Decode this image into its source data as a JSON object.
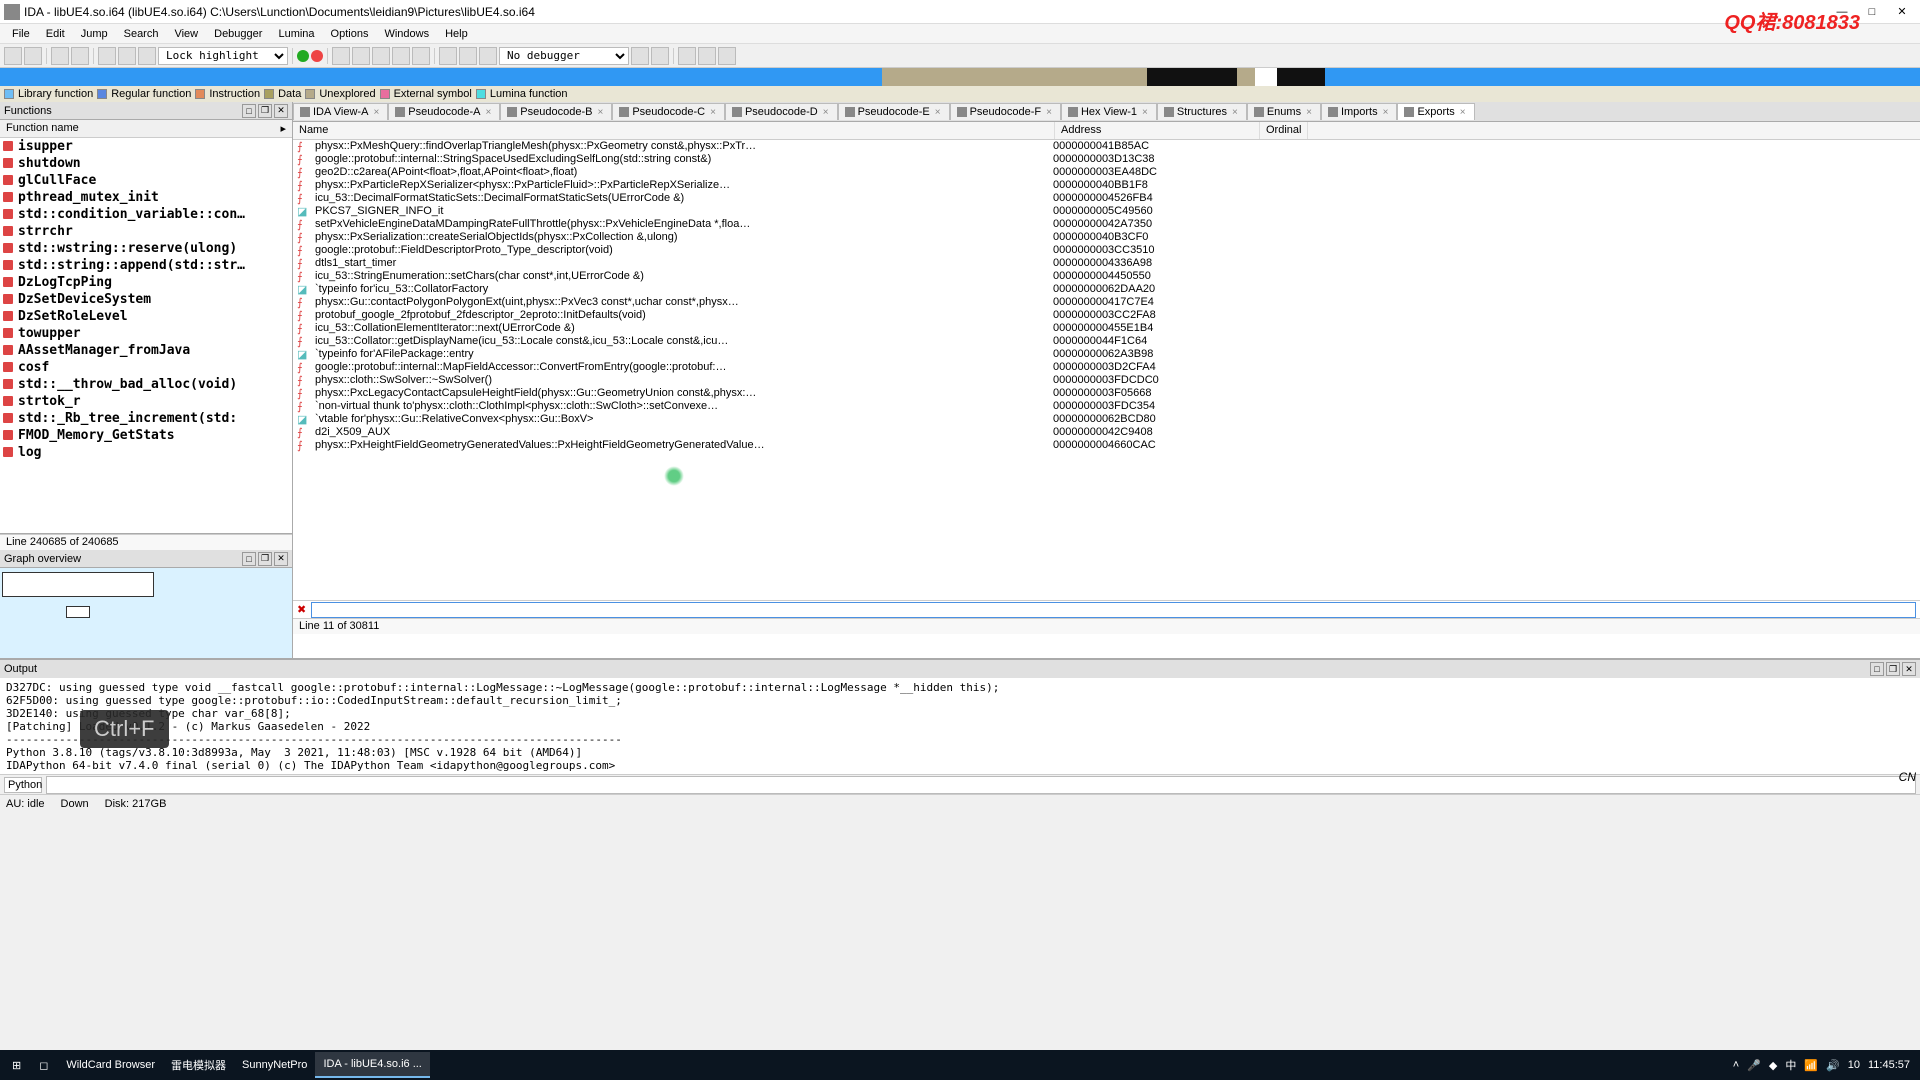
{
  "window": {
    "title": "IDA - libUE4.so.i64 (libUE4.so.i64) C:\\Users\\Lunction\\Documents\\leidian9\\Pictures\\libUE4.so.i64",
    "qq_ad": "QQ裙:8081833"
  },
  "menu": {
    "items": [
      "File",
      "Edit",
      "Jump",
      "Search",
      "View",
      "Debugger",
      "Lumina",
      "Options",
      "Windows",
      "Help"
    ]
  },
  "toolbar": {
    "lockhighlight": "Lock highlight",
    "debugger": "No debugger"
  },
  "legend": {
    "items": [
      {
        "color": "#6fbef5",
        "label": "Library function"
      },
      {
        "color": "#5a87e0",
        "label": "Regular function"
      },
      {
        "color": "#e28a5a",
        "label": "Instruction"
      },
      {
        "color": "#a8a060",
        "label": "Data"
      },
      {
        "color": "#b5aa8a",
        "label": "Unexplored"
      },
      {
        "color": "#e86e9e",
        "label": "External symbol"
      },
      {
        "color": "#4ddde0",
        "label": "Lumina function"
      }
    ]
  },
  "functions": {
    "panel_title": "Functions",
    "col_name": "Function name",
    "items": [
      "isupper",
      "shutdown",
      "glCullFace",
      "pthread_mutex_init",
      "std::condition_variable::con…",
      "strrchr",
      "std::wstring::reserve(ulong)",
      "std::string::append(std::str…",
      "DzLogTcpPing",
      "DzSetDeviceSystem",
      "DzSetRoleLevel",
      "towupper",
      "AAssetManager_fromJava",
      "cosf",
      "std::__throw_bad_alloc(void)",
      "strtok_r",
      "std::_Rb_tree_increment(std:",
      "FMOD_Memory_GetStats",
      "log"
    ],
    "status": "Line 240685 of 240685"
  },
  "graph": {
    "panel_title": "Graph overview"
  },
  "tabs": {
    "items": [
      {
        "label": "IDA View-A"
      },
      {
        "label": "Pseudocode-A"
      },
      {
        "label": "Pseudocode-B"
      },
      {
        "label": "Pseudocode-C"
      },
      {
        "label": "Pseudocode-D"
      },
      {
        "label": "Pseudocode-E"
      },
      {
        "label": "Pseudocode-F"
      },
      {
        "label": "Hex View-1"
      },
      {
        "label": "Structures"
      },
      {
        "label": "Enums"
      },
      {
        "label": "Imports"
      },
      {
        "label": "Exports",
        "active": true
      }
    ]
  },
  "exports": {
    "cols": {
      "name": "Name",
      "address": "Address",
      "ordinal": "Ordinal"
    },
    "rows": [
      {
        "i": "f",
        "n": "physx::PxMeshQuery::findOverlapTriangleMesh(physx::PxGeometry const&,physx::PxTr…",
        "a": "0000000041B85AC"
      },
      {
        "i": "f",
        "n": "google::protobuf::internal::StringSpaceUsedExcludingSelfLong(std::string const&)",
        "a": "0000000003D13C38"
      },
      {
        "i": "f",
        "n": "geo2D::c2area(APoint<float>,float,APoint<float>,float)",
        "a": "0000000003EA48DC"
      },
      {
        "i": "f",
        "n": "physx::PxParticleRepXSerializer<physx::PxParticleFluid>::PxParticleRepXSerialize…",
        "a": "0000000040BB1F8"
      },
      {
        "i": "f",
        "n": "icu_53::DecimalFormatStaticSets::DecimalFormatStaticSets(UErrorCode &)",
        "a": "0000000004526FB4"
      },
      {
        "i": "d",
        "n": "PKCS7_SIGNER_INFO_it",
        "a": "0000000005C49560"
      },
      {
        "i": "f",
        "n": "setPxVehicleEngineDataMDampingRateFullThrottle(physx::PxVehicleEngineData *,floa…",
        "a": "00000000042A7350"
      },
      {
        "i": "f",
        "n": "physx::PxSerialization::createSerialObjectIds(physx::PxCollection &,ulong)",
        "a": "0000000040B3CF0"
      },
      {
        "i": "f",
        "n": "google::protobuf::FieldDescriptorProto_Type_descriptor(void)",
        "a": "0000000003CC3510"
      },
      {
        "i": "f",
        "n": "dtls1_start_timer",
        "a": "0000000004336A98"
      },
      {
        "i": "f",
        "n": "icu_53::StringEnumeration::setChars(char const*,int,UErrorCode &)",
        "a": "0000000004450550"
      },
      {
        "i": "d",
        "n": "`typeinfo for'icu_53::CollatorFactory",
        "a": "00000000062DAA20"
      },
      {
        "i": "f",
        "n": "physx::Gu::contactPolygonPolygonExt(uint,physx::PxVec3 const*,uchar const*,physx…",
        "a": "000000000417C7E4"
      },
      {
        "i": "f",
        "n": "protobuf_google_2fprotobuf_2fdescriptor_2eproto::InitDefaults(void)",
        "a": "0000000003CC2FA8"
      },
      {
        "i": "f",
        "n": "icu_53::CollationElementIterator::next(UErrorCode &)",
        "a": "000000000455E1B4"
      },
      {
        "i": "f",
        "n": "icu_53::Collator::getDisplayName(icu_53::Locale const&,icu_53::Locale const&,icu…",
        "a": "0000000044F1C64"
      },
      {
        "i": "d",
        "n": "`typeinfo for'AFilePackage::entry",
        "a": "00000000062A3B98"
      },
      {
        "i": "f",
        "n": "google::protobuf::internal::MapFieldAccessor::ConvertFromEntry(google::protobuf:…",
        "a": "0000000003D2CFA4"
      },
      {
        "i": "f",
        "n": "physx::cloth::SwSolver::~SwSolver()",
        "a": "0000000003FDCDC0"
      },
      {
        "i": "f",
        "n": "physx::PxcLegacyContactCapsuleHeightField(physx::Gu::GeometryUnion const&,physx:…",
        "a": "0000000003F05668"
      },
      {
        "i": "f",
        "n": "`non-virtual thunk to'physx::cloth::ClothImpl<physx::cloth::SwCloth>::setConvexe…",
        "a": "0000000003FDC354"
      },
      {
        "i": "d",
        "n": "`vtable for'physx::Gu::RelativeConvex<physx::Gu::BoxV>",
        "a": "00000000062BCD80"
      },
      {
        "i": "f",
        "n": "d2i_X509_AUX",
        "a": "00000000042C9408"
      },
      {
        "i": "f",
        "n": "physx::PxHeightFieldGeometryGeneratedValues::PxHeightFieldGeometryGeneratedValue…",
        "a": "0000000004660CAC"
      }
    ],
    "status": "Line 11 of 30811"
  },
  "output": {
    "panel_title": "Output",
    "lines": "D327DC: using guessed type void __fastcall google::protobuf::internal::LogMessage::~LogMessage(google::protobuf::internal::LogMessage *__hidden this);\n62F5D00: using guessed type google::protobuf::io::CodedInputStream::default_recursion_limit_;\n3D2E140: using guessed type char var_68[8];\n[Patching] Loaded v0.1.2 - (c) Markus Gaasedelen - 2022\n---------------------------------------------------------------------------------------------\nPython 3.8.10 (tags/v3.8.10:3d8993a, May  3 2021, 11:48:03) [MSC v.1928 64 bit (AMD64)]\nIDAPython 64-bit v7.4.0 final (serial 0) (c) The IDAPython Team <idapython@googlegroups.com>\n---------------------------------------------------------------------------------------------"
  },
  "python_label": "Python",
  "statusbar": {
    "au": "AU:  idle",
    "down": "Down",
    "disk": "Disk: 217GB"
  },
  "ime": "CN",
  "keypress": "Ctrl+F",
  "taskbar": {
    "items": [
      "WildCard Browser",
      "雷电模拟器",
      "SunnyNetPro",
      "IDA - libUE4.so.i6 ..."
    ],
    "time": "11:45:57",
    "notif_count": "10"
  }
}
